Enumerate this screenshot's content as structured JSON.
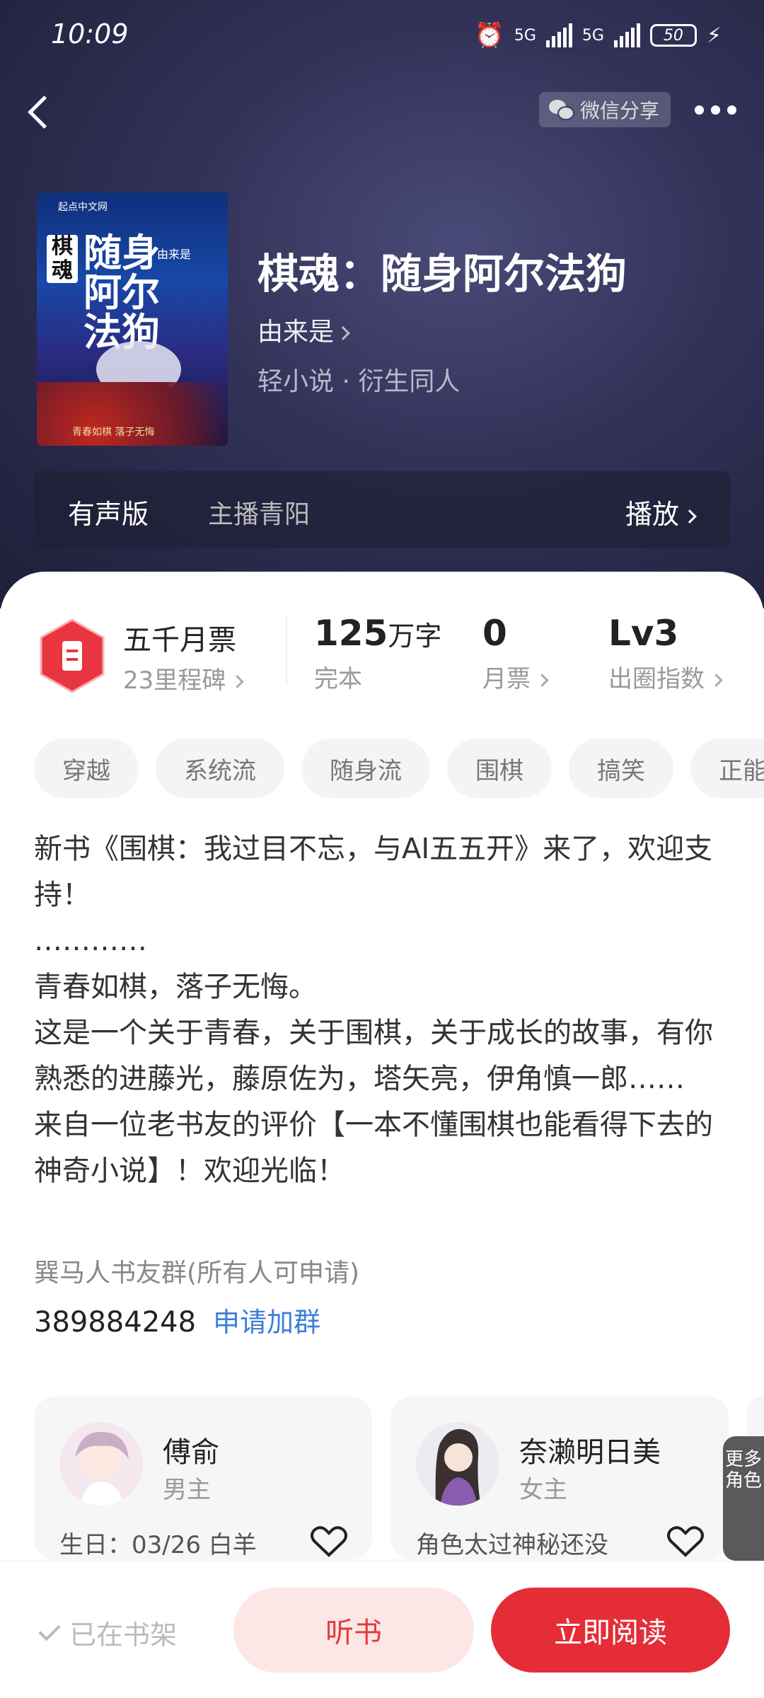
{
  "status": {
    "time": "10:09",
    "signal1": "5G",
    "signal2": "5G",
    "battery": "50"
  },
  "topbar": {
    "share_label": "微信分享"
  },
  "book": {
    "cover_text": {
      "side": "棋魂",
      "main": "随身阿尔法狗",
      "author": "由来是",
      "publisher": "起点中文网",
      "bottom": "青春如棋 落子无悔"
    },
    "title": "棋魂：随身阿尔法狗",
    "author": "由来是",
    "genre": "轻小说 · 衍生同人"
  },
  "audio": {
    "label": "有声版",
    "host": "主播青阳",
    "play": "播放"
  },
  "stats": {
    "monthly_title": "五千月票",
    "monthly_sub": "23里程碑",
    "words_value": "125",
    "words_unit": "万字",
    "words_label": "完本",
    "votes_value": "0",
    "votes_label": "月票",
    "level_value": "Lv3",
    "level_label": "出圈指数"
  },
  "tags": [
    "穿越",
    "系统流",
    "随身流",
    "围棋",
    "搞笑",
    "正能量"
  ],
  "description": {
    "p1": "新书《围棋：我过目不忘，与AI五五开》来了，欢迎支持！",
    "p2": "…………",
    "p3": "青春如棋，落子无悔。",
    "p4": "这是一个关于青春，关于围棋，关于成长的故事，有你熟悉的进藤光，藤原佐为，塔矢亮，伊角慎一郎……",
    "p5": "来自一位老书友的评价【一本不懂围棋也能看得下去的神奇小说】！欢迎光临！"
  },
  "group": {
    "name": "巽马人书友群(所有人可申请)",
    "number": "389884248",
    "apply": "申请加群"
  },
  "roles": [
    {
      "name": "傅俞",
      "role": "男主",
      "info": "生日：03/26 白羊"
    },
    {
      "name": "奈濑明日美",
      "role": "女主",
      "info": "角色太过神秘还没"
    }
  ],
  "more_roles": "更多角色",
  "bottom": {
    "shelf": "已在书架",
    "listen": "听书",
    "read": "立即阅读"
  },
  "colors": {
    "accent": "#e52d38",
    "link": "#3b7fd8",
    "hero_bg": "#2f2f52"
  }
}
